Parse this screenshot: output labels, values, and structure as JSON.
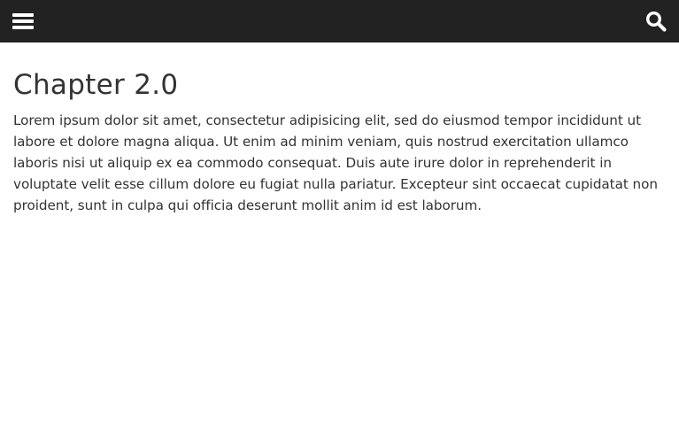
{
  "topbar": {
    "menu_icon": "hamburger-menu-icon",
    "search_icon": "search-icon",
    "background": "#222222"
  },
  "main": {
    "title": "Chapter 2.0",
    "paragraph": "Lorem ipsum dolor sit amet, consectetur adipisicing elit, sed do eiusmod tempor incididunt ut labore et dolore magna aliqua. Ut enim ad minim veniam, quis nostrud exercitation ullamco laboris nisi ut aliquip ex ea commodo consequat. Duis aute irure dolor in reprehenderit in voluptate velit esse cillum dolore eu fugiat nulla pariatur. Excepteur sint occaecat cupidatat non proident, sunt in culpa qui officia deserunt mollit anim id est laborum."
  }
}
